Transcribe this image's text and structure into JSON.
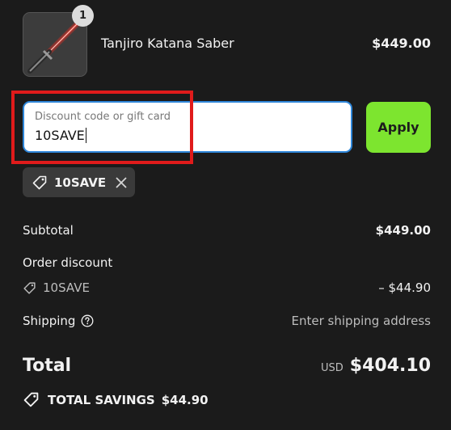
{
  "product": {
    "name": "Tanjiro Katana Saber",
    "price": "$449.00",
    "quantity": "1"
  },
  "discount": {
    "placeholder": "Discount code or gift card",
    "value": "10SAVE",
    "apply_label": "Apply",
    "applied_code": "10SAVE"
  },
  "summary": {
    "subtotal_label": "Subtotal",
    "subtotal_value": "$449.00",
    "order_discount_label": "Order discount",
    "discount_code": "10SAVE",
    "discount_amount": "– $44.90",
    "shipping_label": "Shipping",
    "shipping_value": "Enter shipping address",
    "total_label": "Total",
    "currency": "USD",
    "total_value": "$404.10",
    "savings_label": "TOTAL SAVINGS",
    "savings_value": "$44.90"
  },
  "colors": {
    "background": "#1b1b1b",
    "accent_button": "#7de52f",
    "input_border": "#2e86d9",
    "highlight": "#e01b1b"
  },
  "icons": {
    "tag": "tag-icon",
    "close": "close-icon",
    "help": "help-circle-icon"
  }
}
